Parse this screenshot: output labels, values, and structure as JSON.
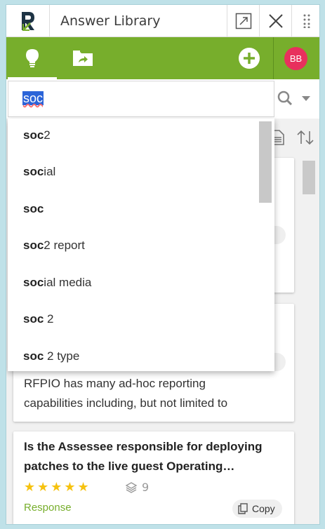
{
  "window": {
    "title": "Answer Library"
  },
  "toolbar": {
    "avatar_initials": "BB",
    "accent_color": "#77ae2c",
    "avatar_color": "#e8305d"
  },
  "search": {
    "value": "soc"
  },
  "suggestions": [
    {
      "match": "soc",
      "rest": "2"
    },
    {
      "match": "soc",
      "rest": "ial"
    },
    {
      "match": "soc",
      "rest": ""
    },
    {
      "match": "soc",
      "rest": "2 report"
    },
    {
      "match": "soc",
      "rest": "ial media"
    },
    {
      "match": "soc",
      "rest": " 2"
    },
    {
      "match": "soc",
      "rest": " 2 type"
    }
  ],
  "cards": {
    "card2": {
      "line1": "RFPIO has many ad-hoc reporting",
      "line2": "capabilities including, but not limited to"
    },
    "card3": {
      "title": "Is the Assessee responsible for deploying patches to the live guest Operating…",
      "stars": "★★★★★",
      "rating": 5,
      "usage_count": "9",
      "type": "Response",
      "copy_label": "Copy"
    }
  }
}
